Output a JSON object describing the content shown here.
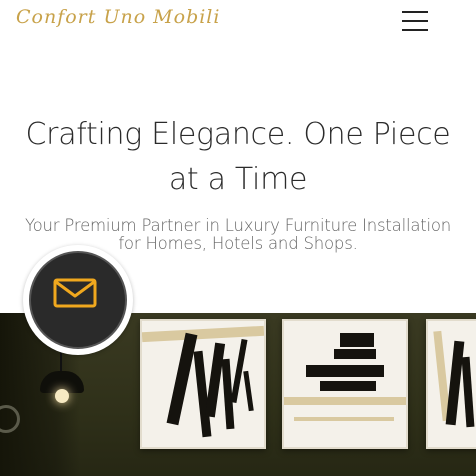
{
  "header": {
    "logo_text": "Confort Uno Mobili",
    "menu_icon": "hamburger-menu-icon"
  },
  "hero": {
    "title": "Crafting Elegance. One Piece at a Time",
    "subtitle": "Your Premium Partner in Luxury Furniture Installation for Homes, Hotels and Shops."
  },
  "contact_fab": {
    "icon": "mail-icon",
    "accent": "#f0a81e"
  },
  "colors": {
    "logo": "#c8a24a",
    "heading": "#2b2b2b",
    "subtitle": "#666666",
    "fab_bg": "#2a2a2a"
  }
}
